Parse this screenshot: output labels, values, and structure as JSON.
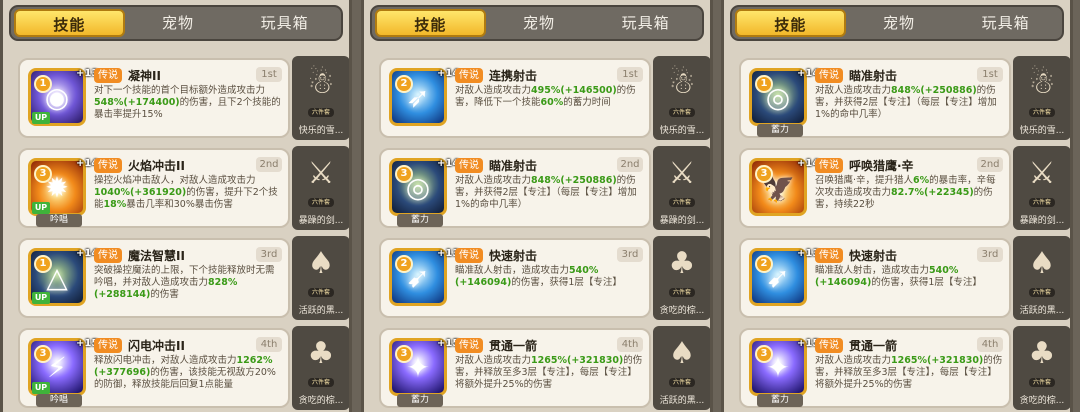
{
  "tabs": [
    "技能",
    "宠物",
    "玩具箱"
  ],
  "legend_badge": "传说",
  "panels": [
    {
      "cards": [
        {
          "level": "1",
          "plus": "+13",
          "up": "UP",
          "tagline": "",
          "name": "凝神II",
          "rank": "1st",
          "desc_parts": [
            "对下一个技能的首个目标额外造成攻击力",
            "548%(+174400)",
            "的伤害，且下2个技能的暴击率提升15%"
          ],
          "pet_name": "快乐的雪..."
        },
        {
          "level": "3",
          "plus": "+14",
          "up": "UP",
          "tagline": "吟唱",
          "name": "火焰冲击II",
          "rank": "2nd",
          "desc_parts": [
            "操控火焰冲击敌人，对敌人造成攻击力",
            "1040%(+361920)",
            "的伤害，提升下2个技能",
            "18%",
            "暴击几率和30%暴击伤害"
          ],
          "pet_name": "暴躁的剑..."
        },
        {
          "level": "1",
          "plus": "+14",
          "up": "UP",
          "tagline": "",
          "name": "魔法智慧II",
          "rank": "3rd",
          "desc_parts": [
            "突破操控魔法的上限，下个技能释放时无需吟唱，并对敌人造成攻击力",
            "828%(+288144)",
            "的伤害"
          ],
          "pet_name": "活跃的黑..."
        },
        {
          "level": "3",
          "plus": "+15",
          "up": "UP",
          "tagline": "吟唱",
          "name": "闪电冲击II",
          "rank": "4th",
          "desc_parts": [
            "释放闪电冲击，对敌人造成攻击力",
            "1262%(+377696)",
            "的伤害，该技能无视敌方20%的防御，释放技能后回复1点能量"
          ],
          "pet_name": "贪吃的棕..."
        }
      ]
    },
    {
      "cards": [
        {
          "level": "2",
          "plus": "+14",
          "up": "",
          "tagline": "",
          "name": "连携射击",
          "rank": "1st",
          "desc_parts": [
            "对敌人造成攻击力",
            "495%(+146500)",
            "的伤害，降低下一个技能",
            "60%",
            "的蓄力时间"
          ],
          "pet_name": "快乐的雪..."
        },
        {
          "level": "3",
          "plus": "+14",
          "up": "",
          "tagline": "蓄力",
          "name": "瞄准射击",
          "rank": "2nd",
          "desc_parts": [
            "对敌人造成攻击力",
            "848%(+250886)",
            "的伤害，并获得2层【专注】（每层【专注】增加1%的命中几率）"
          ],
          "pet_name": "暴躁的剑..."
        },
        {
          "level": "2",
          "plus": "+13",
          "up": "",
          "tagline": "",
          "name": "快速射击",
          "rank": "3rd",
          "desc_parts": [
            "瞄准敌人射击，造成攻击力",
            "540%(+146094)",
            "的伤害，获得1层【专注】"
          ],
          "pet_name": "贪吃的棕..."
        },
        {
          "level": "3",
          "plus": "+15",
          "up": "",
          "tagline": "蓄力",
          "name": "贯通一箭",
          "rank": "4th",
          "desc_parts": [
            "对敌人造成攻击力",
            "1265%(+321830)",
            "的伤害，并释放至多3层【专注】，每层【专注】将额外提升25%的伤害"
          ],
          "pet_name": "活跃的黑..."
        }
      ]
    },
    {
      "cards": [
        {
          "level": "1",
          "plus": "+14",
          "up": "",
          "tagline": "蓄力",
          "name": "瞄准射击",
          "rank": "1st",
          "desc_parts": [
            "对敌人造成攻击力",
            "848%(+250886)",
            "的伤害，并获得2层【专注】（每层【专注】增加1%的命中几率）"
          ],
          "pet_name": "快乐的雪..."
        },
        {
          "level": "3",
          "plus": "+14",
          "up": "",
          "tagline": "",
          "name": "呼唤猎鹰·辛",
          "rank": "2nd",
          "desc_parts": [
            "召唤猎鹰·辛，提升猎人",
            "6%",
            "的暴击率，辛每次攻击造成攻击力",
            "82.7%(+22345)",
            "的伤害，持续22秒"
          ],
          "pet_name": "暴躁的剑..."
        },
        {
          "level": "2",
          "plus": "+13",
          "up": "",
          "tagline": "",
          "name": "快速射击",
          "rank": "3rd",
          "desc_parts": [
            "瞄准敌人射击，造成攻击力",
            "540%(+146094)",
            "的伤害，获得1层【专注】"
          ],
          "pet_name": "活跃的黑..."
        },
        {
          "level": "3",
          "plus": "+15",
          "up": "",
          "tagline": "蓄力",
          "name": "贯通一箭",
          "rank": "4th",
          "desc_parts": [
            "对敌人造成攻击力",
            "1265%(+321830)",
            "的伤害，并释放至多3层【专注】，每层【专注】将额外提升25%的伤害"
          ],
          "pet_name": "贪吃的棕..."
        }
      ]
    }
  ],
  "pet_tier": "六件套",
  "colors": {
    "accent": "#f2b82a",
    "legend": "#f18c22",
    "highlight": "#3a9a17"
  }
}
